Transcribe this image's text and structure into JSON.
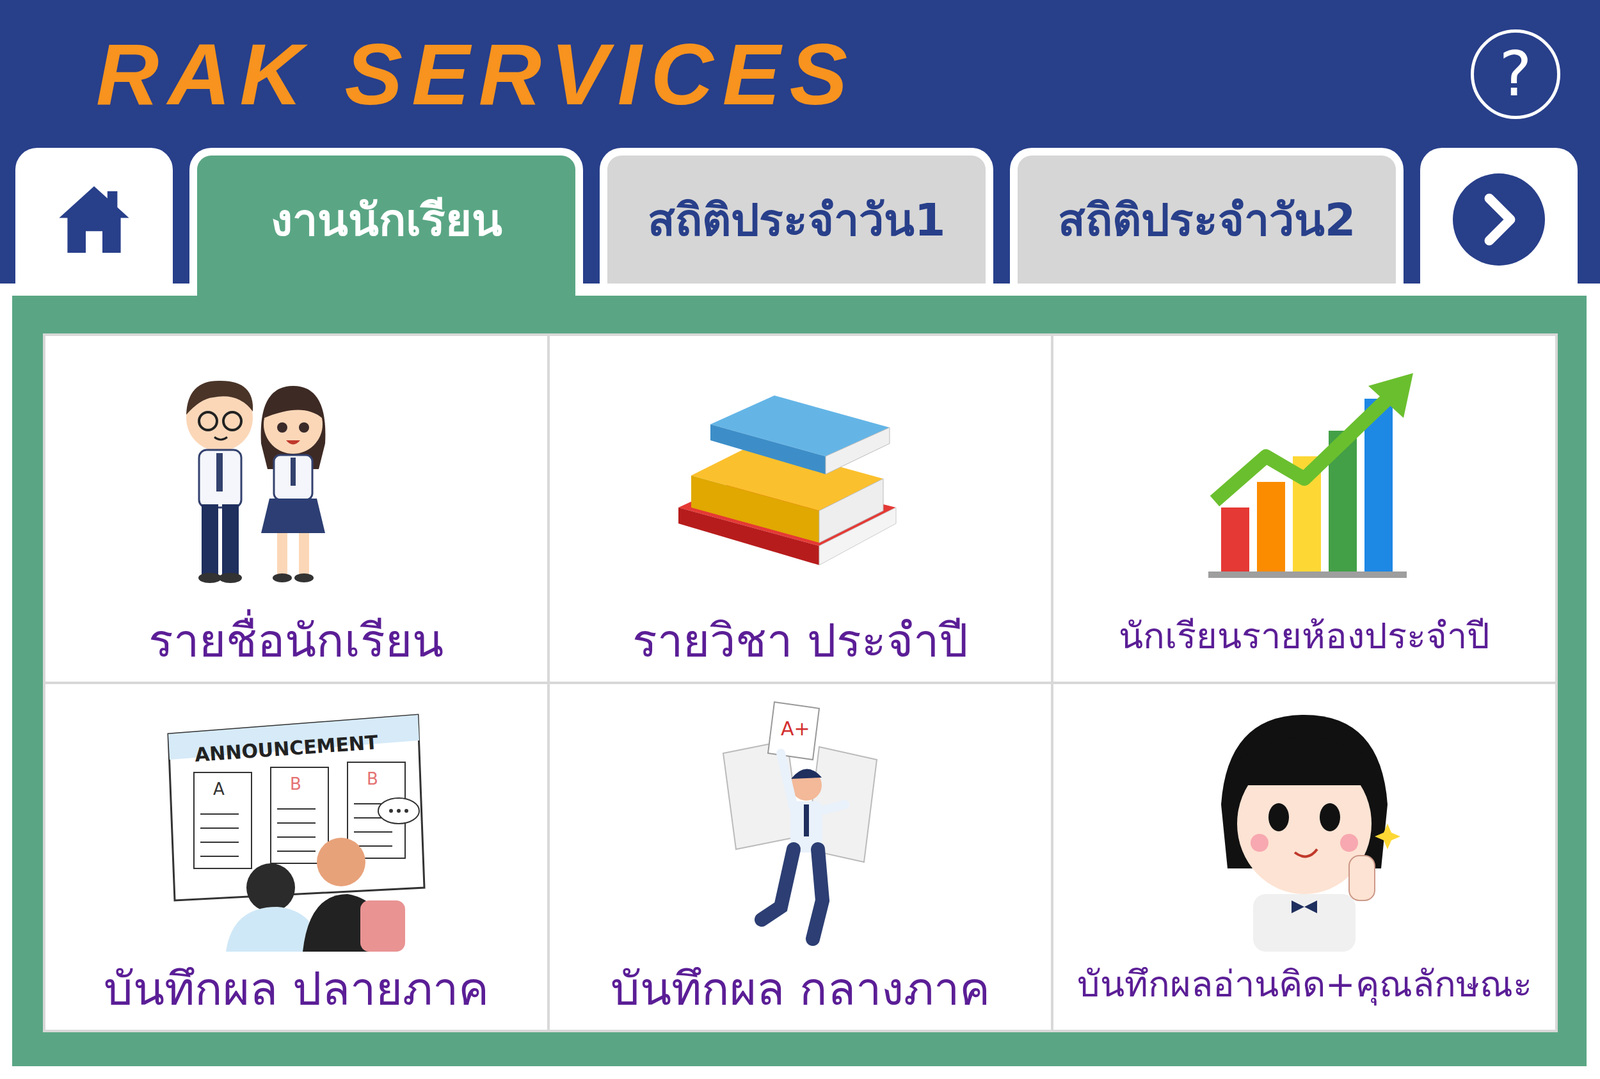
{
  "header": {
    "title": "RAK SERVICES",
    "help": "?"
  },
  "tabs": [
    {
      "label": "",
      "kind": "home",
      "selected": false
    },
    {
      "label": "งานนักเรียน",
      "kind": "text",
      "selected": true
    },
    {
      "label": "สถิติประจำวัน1",
      "kind": "text",
      "selected": false
    },
    {
      "label": "สถิติประจำวัน2",
      "kind": "text",
      "selected": false
    },
    {
      "label": "",
      "kind": "next",
      "selected": false
    }
  ],
  "cards": [
    {
      "label": "รายชื่อนักเรียน",
      "art_text": []
    },
    {
      "label": "รายวิชา ประจำปี",
      "art_text": []
    },
    {
      "label": "นักเรียนรายห้องประจำปี",
      "art_text": []
    },
    {
      "label": "บันทึกผล ปลายภาค",
      "art_text": [
        "ANNOUNCEMENT",
        "A",
        "B",
        "B"
      ]
    },
    {
      "label": "บันทึกผล กลางภาค",
      "art_text": [
        "A+"
      ]
    },
    {
      "label": "บันทึกผลอ่านคิด+คุณลักษณะ",
      "art_text": []
    }
  ]
}
